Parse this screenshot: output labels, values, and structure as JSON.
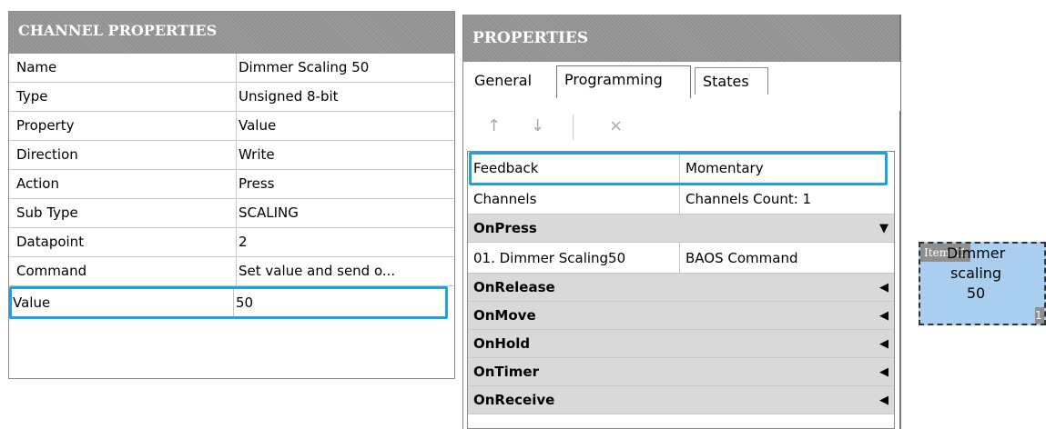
{
  "channel_properties": {
    "title": "CHANNEL PROPERTIES",
    "rows": [
      {
        "key": "Name",
        "value": "Dimmer Scaling 50"
      },
      {
        "key": "Type",
        "value": "Unsigned 8-bit"
      },
      {
        "key": "Property",
        "value": "Value"
      },
      {
        "key": "Direction",
        "value": "Write"
      },
      {
        "key": "Action",
        "value": "Press"
      },
      {
        "key": "Sub Type",
        "value": "SCALING"
      },
      {
        "key": "Datapoint",
        "value": "2"
      },
      {
        "key": "Command",
        "value": "Set value and send o..."
      },
      {
        "key": "Value",
        "value": "50"
      }
    ]
  },
  "properties": {
    "title": "PROPERTIES",
    "tabs": [
      {
        "label": "General"
      },
      {
        "label": "Programming"
      },
      {
        "label": "States"
      }
    ],
    "toolbar": {
      "up_icon": "↑",
      "down_icon": "↓",
      "delete_icon": "×"
    },
    "rows": [
      {
        "key": "Feedback",
        "value": "Momentary"
      },
      {
        "key": "Channels",
        "value": "Channels Count: 1"
      }
    ],
    "groups": [
      {
        "label": "OnPress",
        "expanded": true,
        "items": [
          {
            "key": "01. Dimmer Scaling50",
            "value": "BAOS Command"
          }
        ]
      },
      {
        "label": "OnRelease",
        "expanded": false
      },
      {
        "label": "OnMove",
        "expanded": false
      },
      {
        "label": "OnHold",
        "expanded": false
      },
      {
        "label": "OnTimer",
        "expanded": false
      },
      {
        "label": "OnReceive",
        "expanded": false
      }
    ],
    "arrow_down": "▼",
    "arrow_left": "◀"
  },
  "item": {
    "tag": "Item 11",
    "text": "Dimmer\nscaling\n50",
    "corner": "1",
    "color": "#a9cef0"
  },
  "colors": {
    "highlight": "#1da2e0",
    "header": "#8c8c8c"
  }
}
